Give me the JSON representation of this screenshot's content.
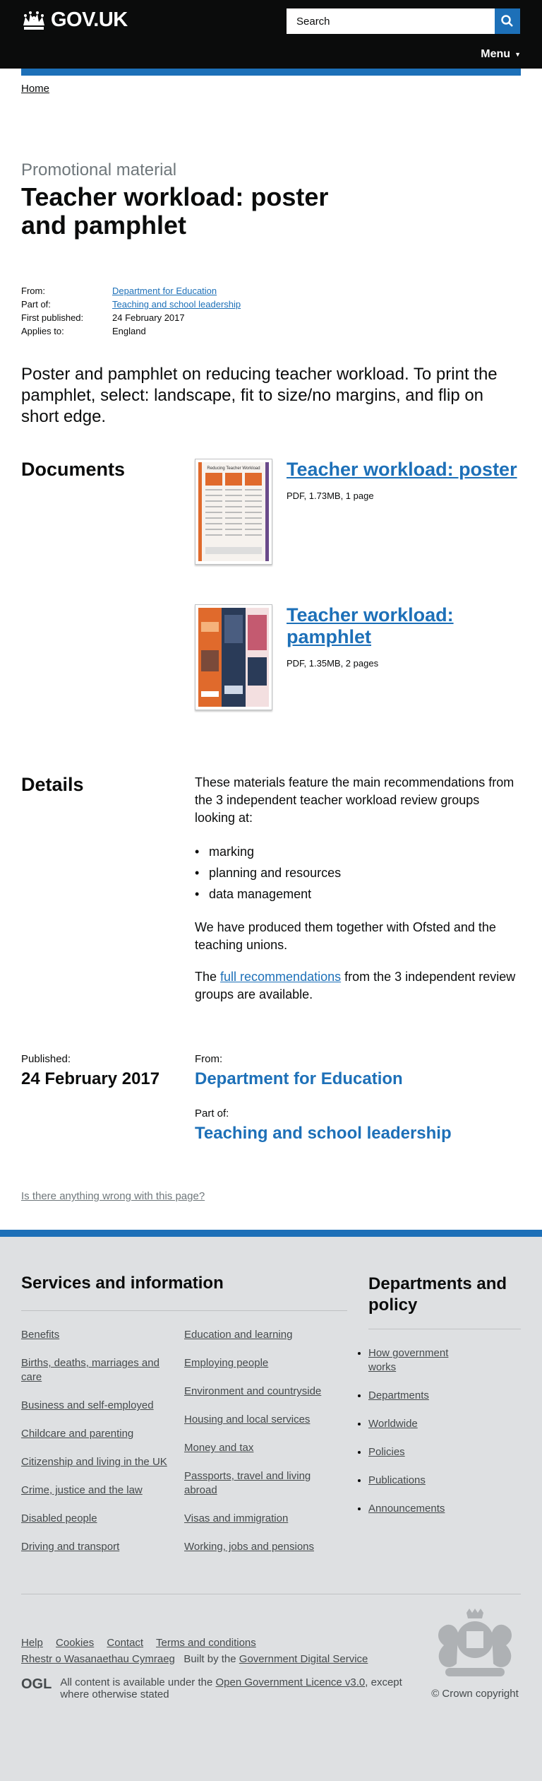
{
  "header": {
    "logo_text": "GOV.UK",
    "search_placeholder": "Search",
    "menu_label": "Menu"
  },
  "breadcrumb": {
    "home": "Home"
  },
  "page": {
    "context": "Promotional material",
    "title": "Teacher workload: poster and pamphlet"
  },
  "metadata": {
    "from_label": "From:",
    "from_value": "Department for Education",
    "part_of_label": "Part of:",
    "part_of_value": "Teaching and school leadership",
    "first_published_label": "First published:",
    "first_published_value": "24 February 2017",
    "applies_to_label": "Applies to:",
    "applies_to_value": "England"
  },
  "lead": "Poster and pamphlet on reducing teacher workload. To print the pamphlet, select: landscape, fit to size/no margins, and flip on short edge.",
  "documents": {
    "heading": "Documents",
    "items": [
      {
        "title": "Teacher workload: poster",
        "meta": "PDF, 1.73MB, 1 page",
        "thumb_title": "Reducing Teacher Workload"
      },
      {
        "title": "Teacher workload: pamphlet",
        "meta": "PDF, 1.35MB, 2 pages"
      }
    ]
  },
  "details": {
    "heading": "Details",
    "intro": "These materials feature the main recommendations from the 3 independent teacher workload review groups looking at:",
    "bullets": [
      "marking",
      "planning and resources",
      "data management"
    ],
    "para2": "We have produced them together with Ofsted and the teaching unions.",
    "para3_pre": "The ",
    "para3_link": "full recommendations",
    "para3_post": " from the 3 independent review groups are available."
  },
  "published": {
    "label": "Published:",
    "date": "24 February 2017",
    "from_label": "From:",
    "from_value": "Department for Education",
    "part_of_label": "Part of:",
    "part_of_value": "Teaching and school leadership"
  },
  "report_link": "Is there anything wrong with this page?",
  "footer": {
    "services_heading": "Services and information",
    "services_col1": [
      "Benefits",
      "Births, deaths, marriages and care",
      "Business and self-employed",
      "Childcare and parenting",
      "Citizenship and living in the UK",
      "Crime, justice and the law",
      "Disabled people",
      "Driving and transport"
    ],
    "services_col2": [
      "Education and learning",
      "Employing people",
      "Environment and countryside",
      "Housing and local services",
      "Money and tax",
      "Passports, travel and living abroad",
      "Visas and immigration",
      "Working, jobs and pensions"
    ],
    "depts_heading": "Departments and policy",
    "depts": [
      "How government works",
      "Departments",
      "Worldwide",
      "Policies",
      "Publications",
      "Announcements"
    ],
    "meta_links": [
      "Help",
      "Cookies",
      "Contact",
      "Terms and conditions"
    ],
    "welsh_link": "Rhestr o Wasanaethau Cymraeg",
    "built_by_pre": "Built by the ",
    "built_by_link": "Government Digital Service",
    "ogl": "OGL",
    "licence_pre": "All content is available under the ",
    "licence_link": "Open Government Licence v3.0",
    "licence_post": ", except where otherwise stated",
    "copyright": "© Crown copyright"
  }
}
